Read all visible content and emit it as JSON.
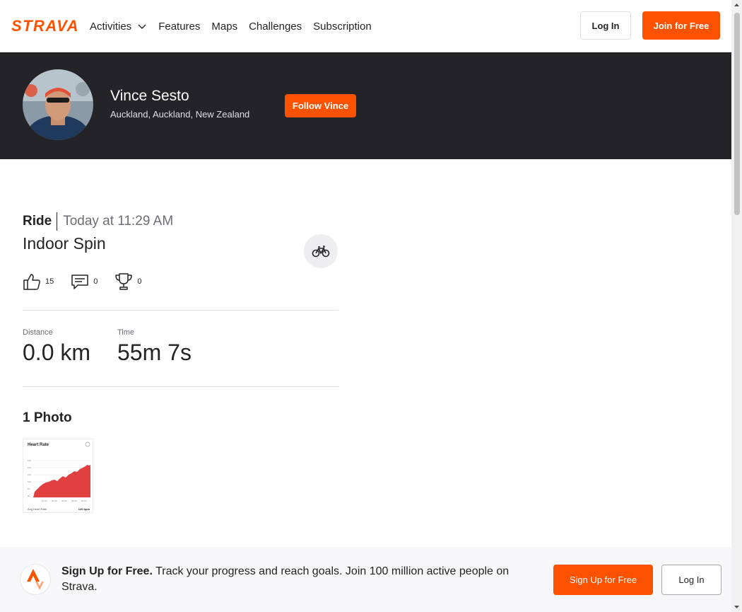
{
  "brand": {
    "logo_text": "STRAVA",
    "accent": "#fc5200",
    "dark": "#242428"
  },
  "nav": {
    "activities_label": "Activities",
    "features_label": "Features",
    "maps_label": "Maps",
    "challenges_label": "Challenges",
    "subscription_label": "Subscription",
    "login_label": "Log In",
    "join_label": "Join for Free"
  },
  "athlete": {
    "name": "Vince Sesto",
    "location": "Auckland, Auckland, New Zealand",
    "follow_label": "Follow Vince"
  },
  "activity": {
    "type": "Ride",
    "date": "Today at 11:29 AM",
    "title": "Indoor Spin",
    "sport_icon": "bike-icon",
    "kudos_count": "15",
    "comments_count": "0",
    "achievements_count": "0",
    "stats": [
      {
        "label": "Distance",
        "value": "0.0 km"
      },
      {
        "label": "Time",
        "value": "55m 7s"
      }
    ],
    "photos_title": "1 Photo",
    "photo": {
      "title": "Heart Rate",
      "footer_label": "Avg Heart Rate",
      "footer_value": "126 bpm"
    }
  },
  "signup": {
    "lead": "Sign Up for Free.",
    "text": " Track your progress and reach goals. Join 100 million active people on Strava.",
    "signup_label": "Sign Up for Free",
    "login_label": "Log In"
  }
}
